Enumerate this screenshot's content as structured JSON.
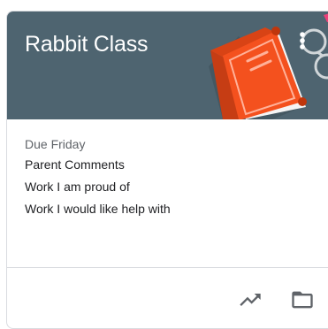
{
  "card": {
    "title": "Rabbit Class",
    "banner_color": "#4e6470",
    "accent_color": "#f4511e",
    "icons": {
      "more": "more-vert-icon",
      "trends": "trending-up-icon",
      "folder": "folder-icon"
    }
  },
  "due": {
    "label": "Due Friday",
    "assignments": [
      "Parent Comments",
      "Work I am proud of",
      "Work I would like help with"
    ]
  }
}
